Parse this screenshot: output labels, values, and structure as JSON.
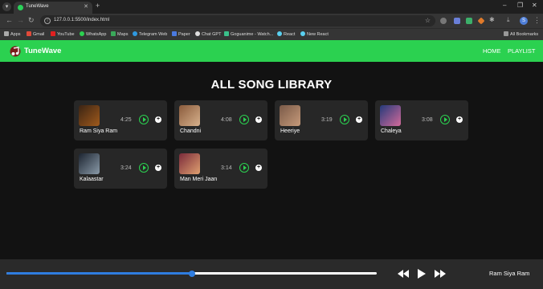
{
  "browser": {
    "tab_title": "TuneWave",
    "url": "127.0.0.1:5500/index.html",
    "profile_initial": "S",
    "bookmarks": [
      "Apps",
      "Gmail",
      "YouTube",
      "WhatsApp",
      "Maps",
      "Telegram Web",
      "Paper",
      "Chat GPT",
      "Goguanime - Watch...",
      "React",
      "New React"
    ],
    "all_bookmarks": "All Bookmarks"
  },
  "header": {
    "brand": "TuneWave",
    "nav": [
      "HOME",
      "PLAYLIST"
    ]
  },
  "library": {
    "title": "ALL SONG LIBRARY",
    "songs": [
      {
        "name": "Ram Siya Ram",
        "duration": "4:25",
        "colors": [
          "#3b2414",
          "#a05a1c"
        ]
      },
      {
        "name": "Chandni",
        "duration": "4:08",
        "colors": [
          "#8a5b3c",
          "#d7b18c"
        ]
      },
      {
        "name": "Heeriye",
        "duration": "3:19",
        "colors": [
          "#7a5a48",
          "#c69a7a"
        ]
      },
      {
        "name": "Chaleya",
        "duration": "3:08",
        "colors": [
          "#243a7a",
          "#d36a9a"
        ]
      },
      {
        "name": "Kalaastar",
        "duration": "3:24",
        "colors": [
          "#1c2430",
          "#8a9aa8"
        ]
      },
      {
        "name": "Man Meri Jaan",
        "duration": "3:14",
        "colors": [
          "#7a2a3a",
          "#e0a070"
        ]
      }
    ]
  },
  "player": {
    "now_playing": "Ram Siya Ram",
    "progress": 0.5
  },
  "colors": {
    "accent": "#2bd150",
    "seek": "#2f7de0",
    "background": "#121212",
    "card": "#272727"
  }
}
